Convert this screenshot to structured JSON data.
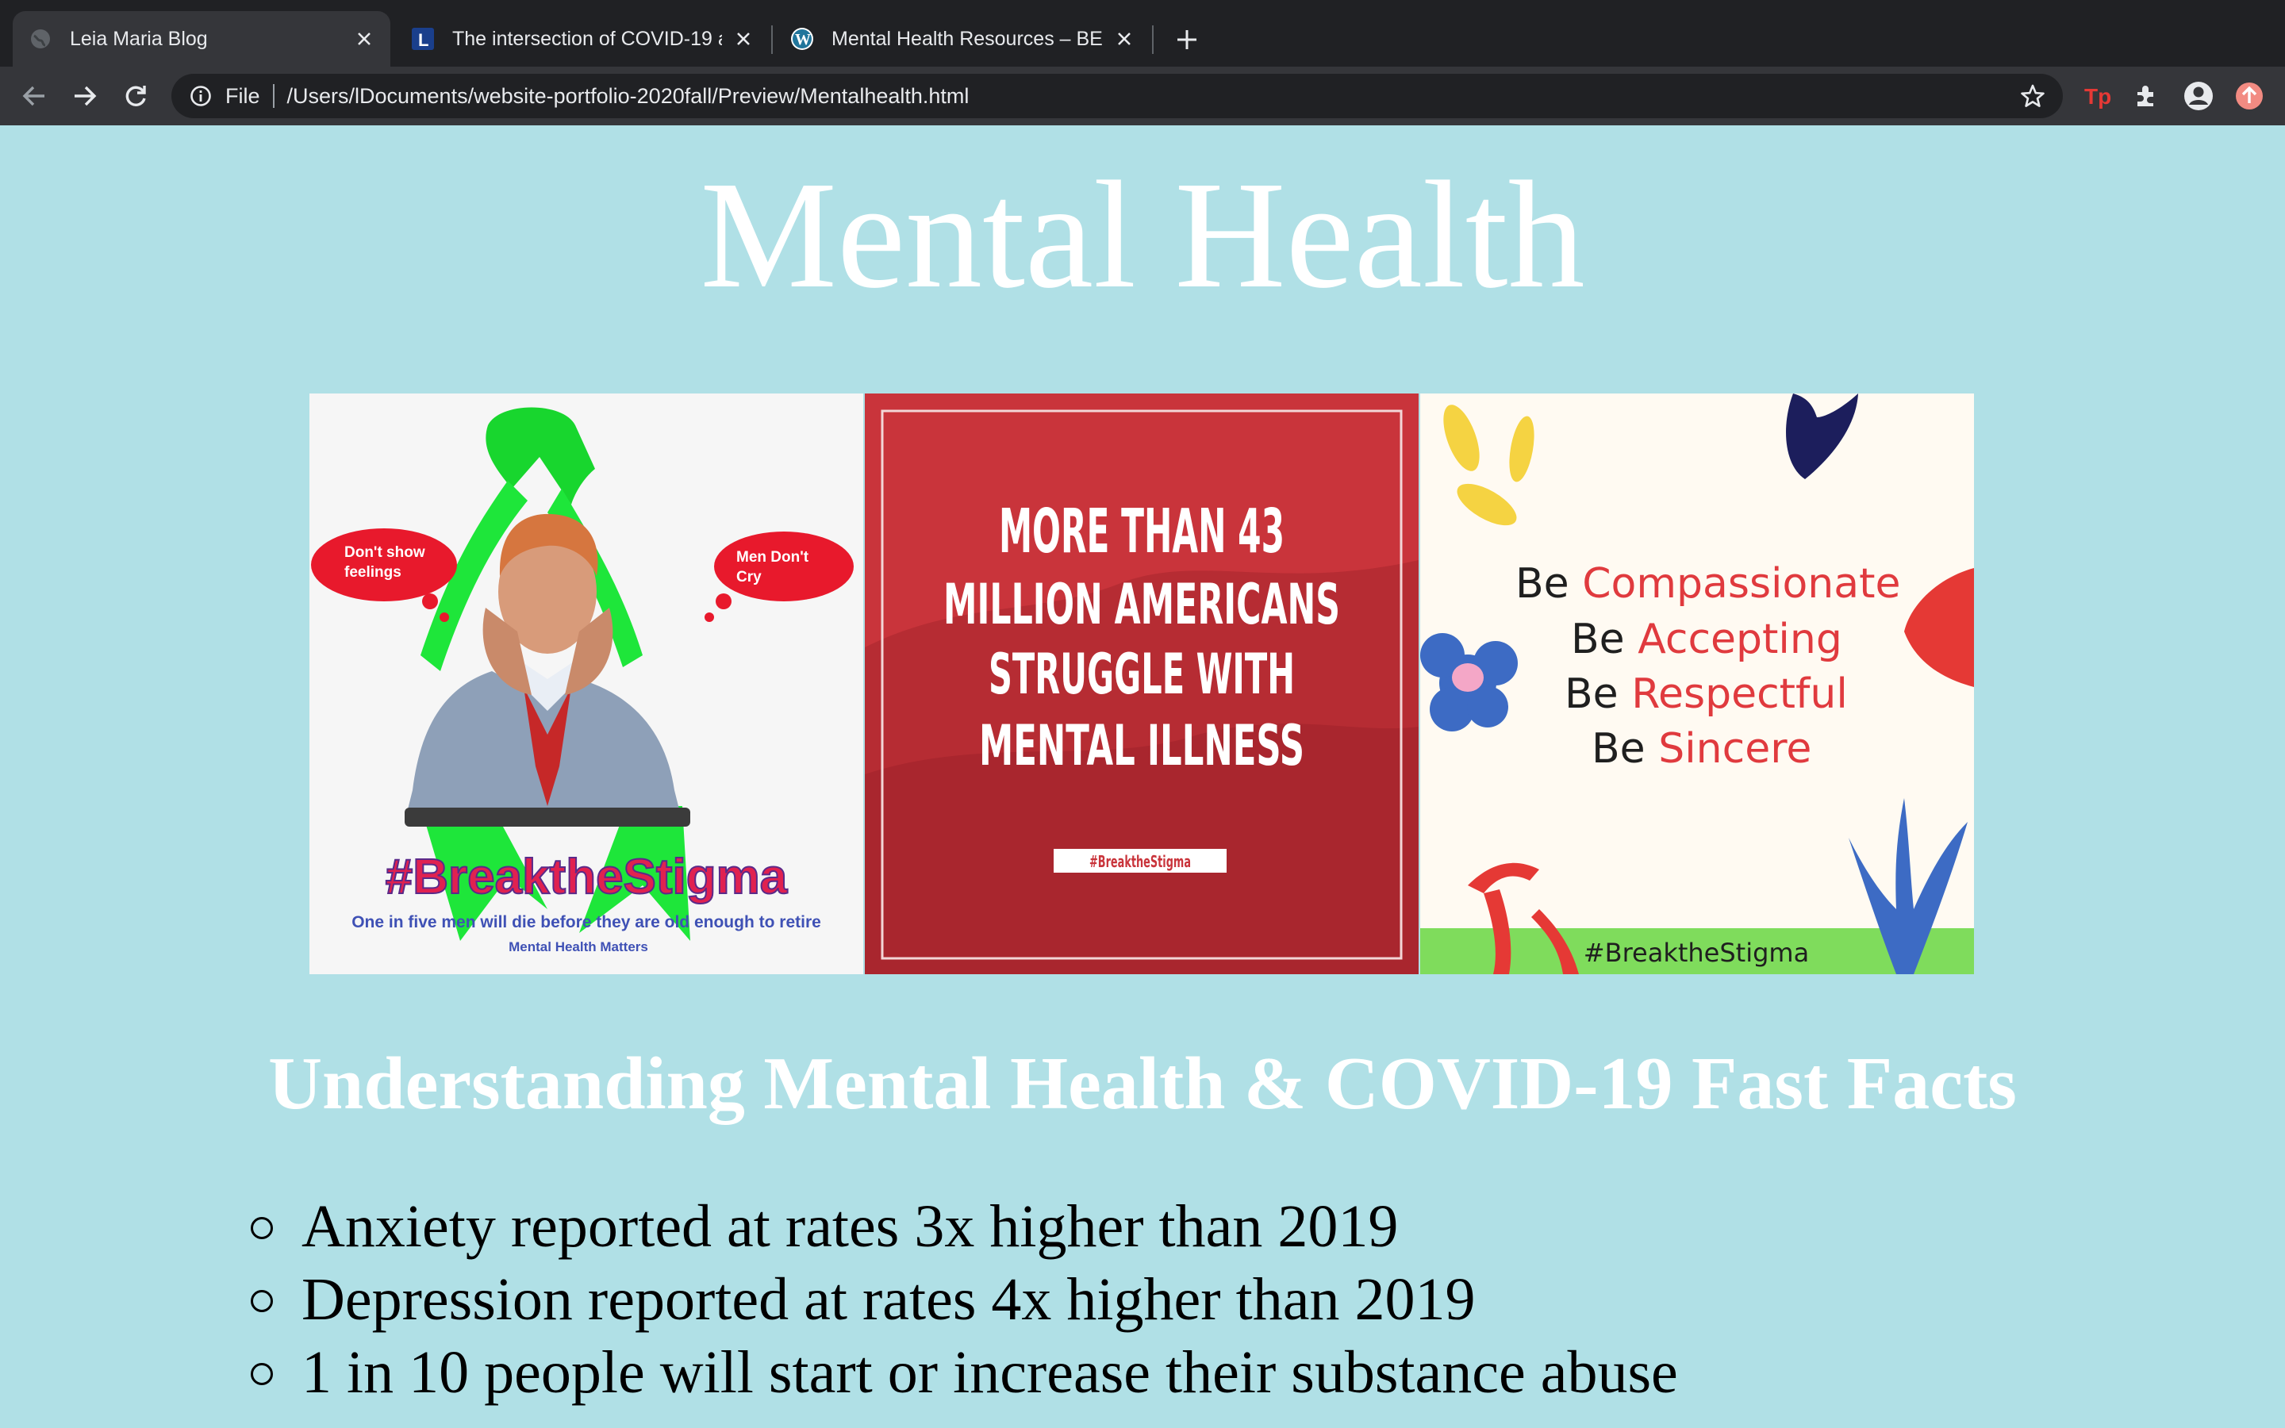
{
  "browser": {
    "tabs": [
      {
        "title": "Leia Maria Blog",
        "active": true,
        "favicon": "globe-icon"
      },
      {
        "title": "The intersection of COVID-19 a",
        "active": false,
        "favicon": "l-letter-icon"
      },
      {
        "title": "Mental Health Resources – BE",
        "active": false,
        "favicon": "wordpress-icon"
      }
    ],
    "address_scheme": "File",
    "address_url": "/Users/lDocuments/website-portfolio-2020fall/Preview/Mentalhealth.html",
    "extensions": [
      "tp-extension-icon",
      "puzzle-icon",
      "profile-icon",
      "update-icon"
    ]
  },
  "page": {
    "title": "Mental Health",
    "images": {
      "left": {
        "thought_left": "Don't show feelings",
        "thought_right": "Men Don't Cry",
        "hashtag": "#BreaktheStigma",
        "caption": "One in five men will die before they are old enough to retire",
        "footer": "Mental Health Matters"
      },
      "middle": {
        "lines": [
          "MORE THAN 43",
          "MILLION AMERICANS",
          "STRUGGLE WITH",
          "MENTAL ILLNESS"
        ],
        "hashtag": "#BreaktheStigma"
      },
      "right": {
        "prefix": "Be",
        "words": [
          "Compassionate",
          "Accepting",
          "Respectful",
          "Sincere"
        ],
        "hashtag": "#BreaktheStigma"
      }
    },
    "section_heading": "Understanding Mental Health & COVID-19 Fast Facts",
    "facts": [
      "Anxiety reported at rates 3x higher than 2019",
      "Depression reported at rates 4x higher than 2019",
      "1 in 10 people will start or increase their substance abuse"
    ]
  },
  "colors": {
    "page_background": "#b0e0e6",
    "chrome_dark": "#202124",
    "chrome_mid": "#35363a",
    "ribbon_green": "#1ee63a",
    "poster_red": "#c9343b",
    "accent_red": "#e03a3e"
  }
}
